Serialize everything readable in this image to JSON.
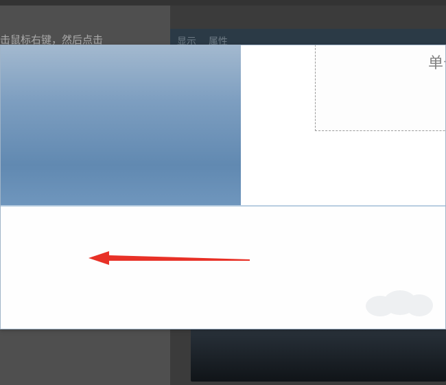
{
  "background": {
    "sidebar_text": "击鼠标右键，然后点击",
    "panel_tabs": {
      "tab1": "显示",
      "tab2": "属性"
    }
  },
  "popup": {
    "dashed_box_text": "单击以",
    "arrow_color": "#e83127",
    "gradient_top": "#a3b9cf",
    "gradient_bottom": "#6189b1"
  }
}
